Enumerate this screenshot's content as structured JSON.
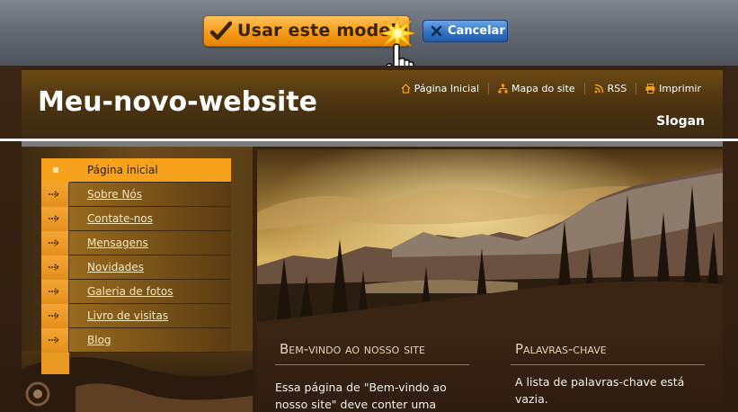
{
  "toolbar": {
    "use_label": "Usar este modelo",
    "cancel_label": "Cancelar"
  },
  "site": {
    "title": "Meu-novo-website",
    "slogan": "Slogan",
    "top_links": [
      "Página Inicial",
      "Mapa do site",
      "RSS",
      "Imprimir"
    ]
  },
  "menu": {
    "items": [
      "Página inicial",
      "Sobre Nós",
      "Contate-nos",
      "Mensagens",
      "Novidades",
      "Galeria de fotos",
      "Livro de visitas",
      "Blog"
    ],
    "active_index": 0
  },
  "content": {
    "welcome_title": "Bem-vindo ao nosso site",
    "welcome_text": "Essa página de \"Bem-vindo ao nosso site\" deve conter uma introdução à",
    "keywords_title": "Palavras-chave",
    "keywords_text": "A lista de palavras-chave está vazia."
  },
  "colors": {
    "accent_orange": "#f6a21c",
    "cancel_blue": "#2f6fc0",
    "site_brown": "#3a2413"
  }
}
